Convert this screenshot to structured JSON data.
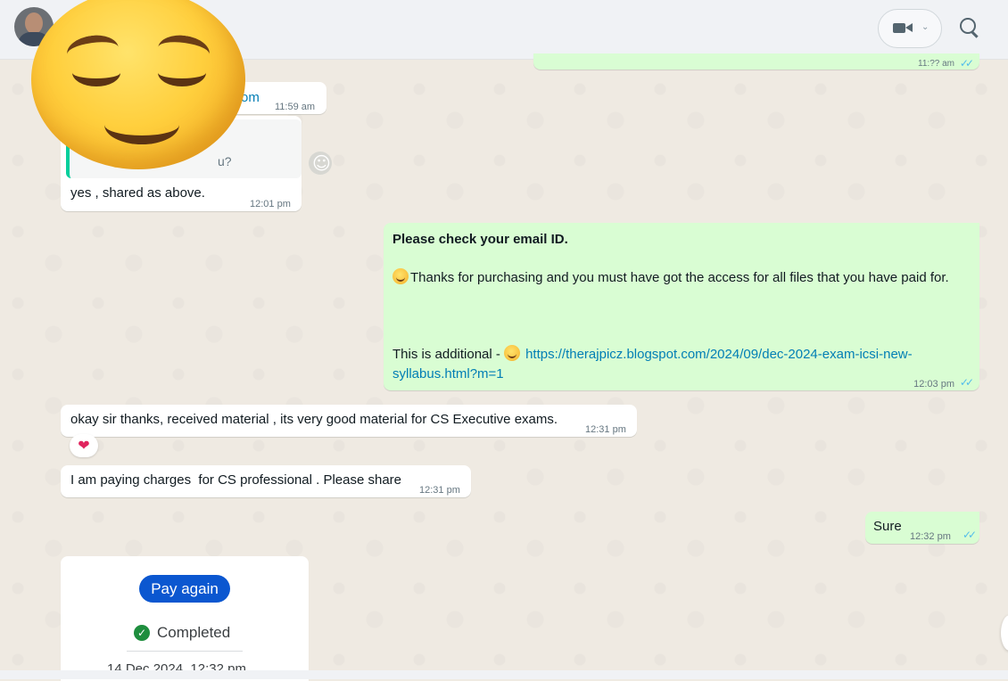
{
  "messages": {
    "m1": {
      "time": "11:?? am"
    },
    "m2": {
      "text": "om",
      "time": "11:59 am"
    },
    "m3": {
      "quoted": "u?",
      "text": "yes , shared as above.",
      "time": "12:01 pm"
    },
    "m4": {
      "bold": "Please check your email ID.",
      "para1": "Thanks for purchasing and you must have got the access for all files that you have paid for.",
      "para2_prefix": "This is additional - ",
      "link": "https://therajpicz.blogspot.com/2024/09/dec-2024-exam-icsi-new-syllabus.html?m=1",
      "time": "12:03 pm"
    },
    "m5": {
      "text": "okay sir thanks, received material , its very good material for CS Executive exams.",
      "time": "12:31 pm",
      "reaction": "❤"
    },
    "m6": {
      "text": "I am paying charges  for CS professional . Please share",
      "time": "12:31 pm"
    },
    "m7": {
      "text": "Sure",
      "time": "12:32 pm"
    }
  },
  "payment_card": {
    "button_label": "Pay again",
    "status": "Completed",
    "date": "14 Dec 2024, 12:32 pm"
  },
  "icons": {
    "header": [
      "avatar",
      "video-call-icon",
      "chevron-down-icon",
      "search-icon"
    ],
    "overlay": "relieved-face-emoji"
  },
  "colors": {
    "outgoing_bubble": "#d9fdd3",
    "incoming_bubble": "#ffffff",
    "link": "#027eb5",
    "read_tick": "#53bdeb",
    "pay_button": "#0b57d0"
  }
}
